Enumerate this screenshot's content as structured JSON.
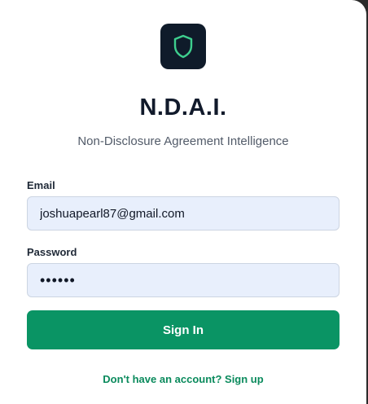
{
  "app": {
    "title": "N.D.A.I.",
    "subtitle": "Non-Disclosure Agreement Intelligence",
    "logo_icon": "shield-icon",
    "logo_bg": "#0f1b2a",
    "logo_accent": "#3ecf8e"
  },
  "form": {
    "email_label": "Email",
    "email_value": "joshuapearl87@gmail.com",
    "password_label": "Password",
    "password_value": "••••••",
    "submit_label": "Sign In",
    "submit_color": "#0a9464"
  },
  "footer": {
    "signup_text": "Don't have an account? Sign up"
  }
}
